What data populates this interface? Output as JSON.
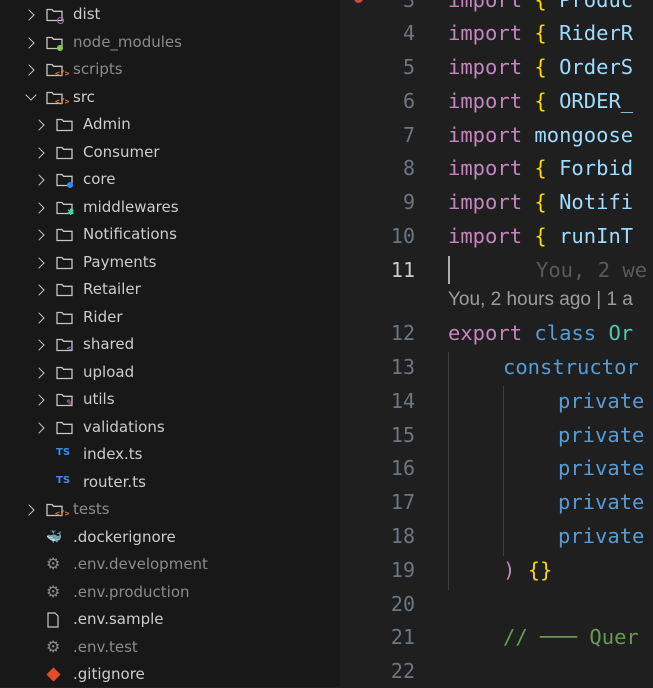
{
  "explorer": {
    "items": [
      {
        "label": "dist",
        "icon": "folder-dist-icon"
      },
      {
        "label": "node_modules",
        "icon": "folder-node-icon"
      },
      {
        "label": "scripts",
        "icon": "folder-scripts-icon"
      },
      {
        "label": "src",
        "icon": "folder-src-icon"
      },
      {
        "label": "Admin",
        "icon": "folder-icon"
      },
      {
        "label": "Consumer",
        "icon": "folder-icon"
      },
      {
        "label": "core",
        "icon": "folder-core-icon"
      },
      {
        "label": "middlewares",
        "icon": "folder-middlewares-icon"
      },
      {
        "label": "Notifications",
        "icon": "folder-icon"
      },
      {
        "label": "Payments",
        "icon": "folder-icon"
      },
      {
        "label": "Retailer",
        "icon": "folder-icon"
      },
      {
        "label": "Rider",
        "icon": "folder-icon"
      },
      {
        "label": "shared",
        "icon": "folder-shared-icon"
      },
      {
        "label": "upload",
        "icon": "folder-icon"
      },
      {
        "label": "utils",
        "icon": "folder-utils-icon"
      },
      {
        "label": "validations",
        "icon": "folder-icon"
      },
      {
        "label": "index.ts",
        "icon": "typescript-file-icon"
      },
      {
        "label": "router.ts",
        "icon": "typescript-file-icon"
      },
      {
        "label": "tests",
        "icon": "folder-tests-icon"
      },
      {
        "label": ".dockerignore",
        "icon": "docker-icon"
      },
      {
        "label": ".env.development",
        "icon": "gear-icon"
      },
      {
        "label": ".env.production",
        "icon": "gear-icon"
      },
      {
        "label": ".env.sample",
        "icon": "file-icon"
      },
      {
        "label": ".env.test",
        "icon": "gear-icon"
      },
      {
        "label": ".gitignore",
        "icon": "git-icon"
      }
    ],
    "ts_badge": "TS",
    "colors": {
      "folder": "#c5c5c5",
      "ts": "#3b8eea",
      "git": "#e44d26",
      "dim_text": "#8b8b8b"
    }
  },
  "editor": {
    "line_numbers": [
      "3",
      "4",
      "5",
      "6",
      "7",
      "8",
      "9",
      "10",
      "11",
      "12",
      "13",
      "14",
      "15",
      "16",
      "17",
      "18",
      "19",
      "20",
      "21",
      "22"
    ],
    "active_line": "11",
    "lines": {
      "l3": {
        "kw": "import",
        "br": "{",
        "id": "Produc"
      },
      "l4": {
        "kw": "import",
        "br": "{",
        "id": "RiderR"
      },
      "l5": {
        "kw": "import",
        "br": "{",
        "id": "OrderS"
      },
      "l6": {
        "kw": "import",
        "br": "{",
        "id": "ORDER_"
      },
      "l7": {
        "kw": "import",
        "id": "mongoose"
      },
      "l8": {
        "kw": "import",
        "br": "{",
        "id": "Forbid"
      },
      "l9": {
        "kw": "import",
        "br": "{",
        "id": "Notifi"
      },
      "l10": {
        "kw": "import",
        "br": "{",
        "id": "runInT"
      },
      "l11": {
        "ghost": "You, 2 we"
      },
      "l12": {
        "kw": "export",
        "kb": "class",
        "cls": "Or"
      },
      "l13": {
        "id": "constructor"
      },
      "l14": {
        "pv": "private"
      },
      "l15": {
        "pv": "private"
      },
      "l16": {
        "pv": "private"
      },
      "l17": {
        "pv": "private"
      },
      "l18": {
        "pv": "private"
      },
      "l19": {
        "paren": ")",
        "br": "{}"
      },
      "l21": {
        "cm": "// ─── Quer"
      }
    },
    "blame": "You, 2 hours ago | 1 a"
  }
}
